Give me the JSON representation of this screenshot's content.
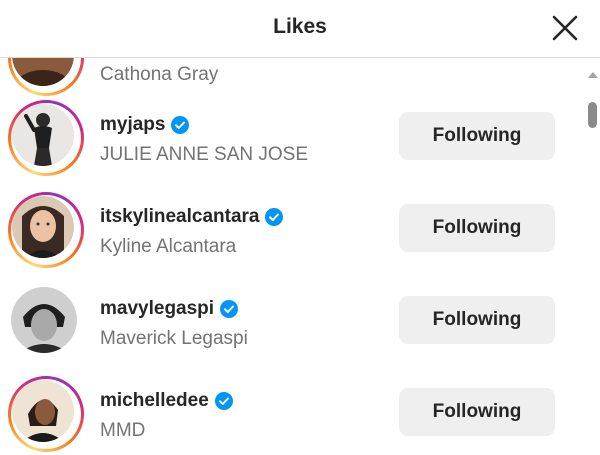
{
  "header": {
    "title": "Likes",
    "close_icon": "close-icon"
  },
  "partial_row": {
    "fullname": "Cathona Gray"
  },
  "rows": [
    {
      "username": "myjaps",
      "fullname": "JULIE ANNE SAN JOSE",
      "button": "Following",
      "verified": true,
      "story_ring": true
    },
    {
      "username": "itskylinealcantara",
      "fullname": "Kyline Alcantara",
      "button": "Following",
      "verified": true,
      "story_ring": true
    },
    {
      "username": "mavylegaspi",
      "fullname": "Maverick Legaspi",
      "button": "Following",
      "verified": true,
      "story_ring": false
    },
    {
      "username": "michelledee",
      "fullname": "MMD",
      "button": "Following",
      "verified": true,
      "story_ring": true
    }
  ],
  "colors": {
    "verified_blue": "#0095f6",
    "button_bg": "#efefef",
    "secondary_text": "#737373"
  }
}
